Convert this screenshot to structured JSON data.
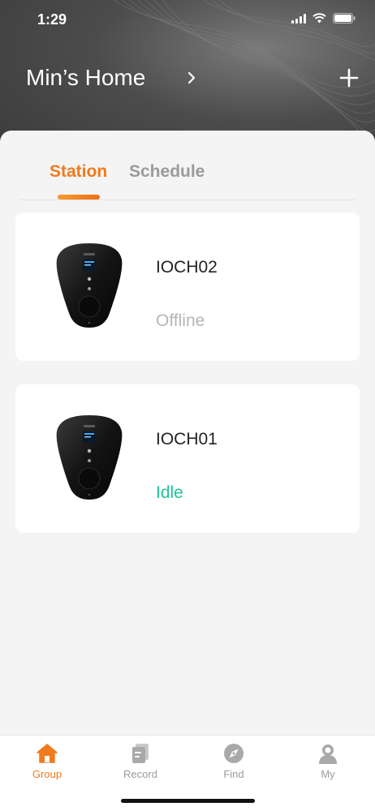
{
  "status_bar": {
    "time": "1:29"
  },
  "header": {
    "title": "Min’s Home"
  },
  "tabs": [
    {
      "label": "Station",
      "active": true
    },
    {
      "label": "Schedule",
      "active": false
    }
  ],
  "stations": [
    {
      "name": "IOCH02",
      "status": "Offline",
      "status_color": "#b5b5b5"
    },
    {
      "name": "IOCH01",
      "status": "Idle",
      "status_color": "#1fc49a"
    }
  ],
  "tabbar": [
    {
      "label": "Group",
      "icon": "home-icon",
      "active": true
    },
    {
      "label": "Record",
      "icon": "record-icon",
      "active": false
    },
    {
      "label": "Find",
      "icon": "compass-icon",
      "active": false
    },
    {
      "label": "My",
      "icon": "person-icon",
      "active": false
    }
  ],
  "colors": {
    "accent": "#f07a1e",
    "idle": "#1fc49a",
    "offline": "#b5b5b5"
  }
}
